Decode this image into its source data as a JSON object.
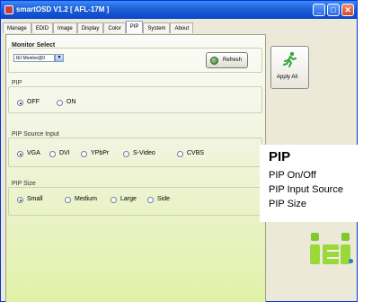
{
  "window": {
    "title": "smartOSD V1.2 [ AFL-17M ]"
  },
  "tabs": [
    {
      "label": "Manage",
      "active": false
    },
    {
      "label": "EDID",
      "active": false
    },
    {
      "label": "Image",
      "active": false
    },
    {
      "label": "Display",
      "active": false
    },
    {
      "label": "Color",
      "active": false
    },
    {
      "label": "PIP",
      "active": true
    },
    {
      "label": "System",
      "active": false
    },
    {
      "label": "About",
      "active": false
    }
  ],
  "monitor_select": {
    "title": "Monitor Select",
    "value": "IEI Monitor@0",
    "refresh_label": "Refresh"
  },
  "apply_all": {
    "label": "Apply All"
  },
  "pip": {
    "title": "PIP",
    "options": [
      {
        "label": "OFF",
        "checked": true
      },
      {
        "label": "ON",
        "checked": false
      }
    ]
  },
  "pip_source": {
    "title": "PIP Source Input",
    "options": [
      {
        "label": "VGA",
        "checked": true
      },
      {
        "label": "DVI",
        "checked": false
      },
      {
        "label": "YPbPr",
        "checked": false
      },
      {
        "label": "S-Video",
        "checked": false
      },
      {
        "label": "CVBS",
        "checked": false
      }
    ]
  },
  "pip_size": {
    "title": "PIP Size",
    "options": [
      {
        "label": "Small",
        "checked": true
      },
      {
        "label": "Medium",
        "checked": false
      },
      {
        "label": "Large",
        "checked": false
      },
      {
        "label": "Side",
        "checked": false
      }
    ]
  },
  "info_box": {
    "title": "PIP",
    "lines": [
      "PIP On/Off",
      "PIP Input Source",
      "PIP Size"
    ]
  },
  "colors": {
    "titlebar": "#1d5fd8",
    "panel_bottom": "#e1f1a8",
    "logo_green": "#9bd83a",
    "logo_blue_dot": "#1f7ed6"
  },
  "icons": {
    "app": "app-icon",
    "refresh": "refresh-icon",
    "apply_all": "running-man-icon",
    "minimize": "minimize-icon",
    "maximize": "maximize-icon",
    "close": "close-icon"
  }
}
